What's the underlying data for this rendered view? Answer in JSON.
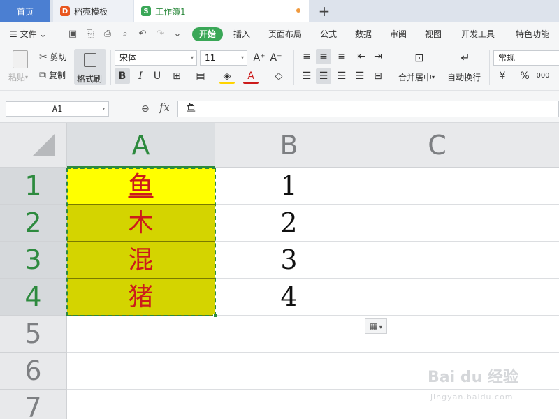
{
  "tabs": {
    "home": "首页",
    "template": "稻壳模板",
    "workbook": "工作簿1",
    "new_tab": "+"
  },
  "menu": {
    "file": "文件",
    "items": [
      "开始",
      "插入",
      "页面布局",
      "公式",
      "数据",
      "审阅",
      "视图",
      "开发工具",
      "特色功能"
    ]
  },
  "ribbon": {
    "paste": "粘贴",
    "cut": "剪切",
    "copy": "复制",
    "format_painter": "格式刷",
    "font_name": "宋体",
    "font_size": "11",
    "grow_font": "A⁺",
    "shrink_font": "A⁻",
    "bold": "B",
    "italic": "I",
    "underline": "U",
    "merge_center": "合并居中",
    "wrap_text": "自动换行",
    "number_format": "常规",
    "currency": "¥",
    "percent": "%",
    "thousands": "000"
  },
  "formula_bar": {
    "cell_ref": "A1",
    "fx": "fx",
    "content": "鱼"
  },
  "sheet": {
    "columns": [
      "A",
      "B",
      "C"
    ],
    "rows": [
      "1",
      "2",
      "3",
      "4",
      "5",
      "6",
      "7"
    ],
    "cells": {
      "A1": "鱼",
      "A2": "木",
      "A3": "混",
      "A4": "猪",
      "B1": "1",
      "B2": "2",
      "B3": "3",
      "B4": "4"
    },
    "active_column": "A"
  },
  "colors": {
    "accent": "#3aa757",
    "cell_highlight": "#ffff00",
    "cell_fill": "#d4d400",
    "cell_text": "#cc1b1b"
  },
  "watermark": {
    "brand": "Bai du 经验",
    "url": "jingyan.baidu.com"
  }
}
